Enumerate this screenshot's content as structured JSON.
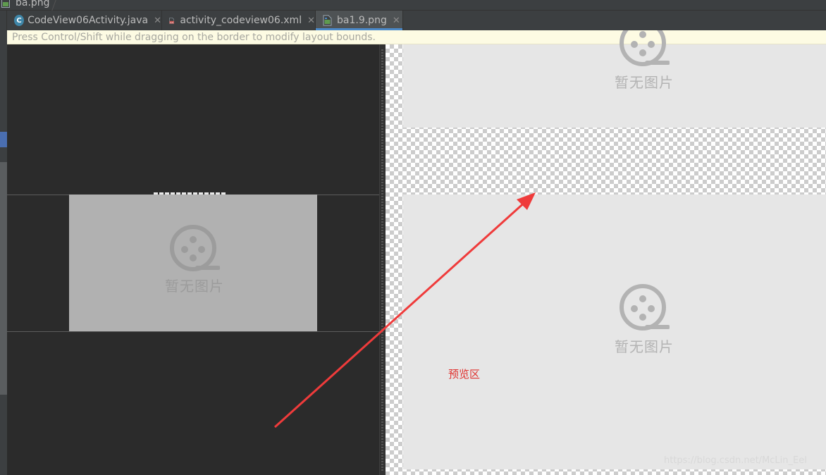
{
  "breadcrumb": {
    "file": "ba.png"
  },
  "tabs": [
    {
      "label": "CodeView06Activity.java",
      "icon": "java-class-icon"
    },
    {
      "label": "activity_codeview06.xml",
      "icon": "xml-file-icon"
    },
    {
      "label": "ba1.9.png",
      "icon": "png-file-icon",
      "active": true
    }
  ],
  "hint": {
    "text": "Press Control/Shift while dragging on the border to modify layout bounds."
  },
  "editor": {
    "placeholder_label": "暂无图片",
    "placeholder_icon": "film-reel-icon"
  },
  "preview": {
    "top_label": "暂无图片",
    "bottom_label": "暂无图片",
    "annotation": "预览区",
    "watermark": "https://blog.csdn.net/McLin_Eel"
  },
  "colors": {
    "accent": "#4a88c7",
    "annotation": "#e0322f",
    "arrow": "#ef3b3b"
  }
}
